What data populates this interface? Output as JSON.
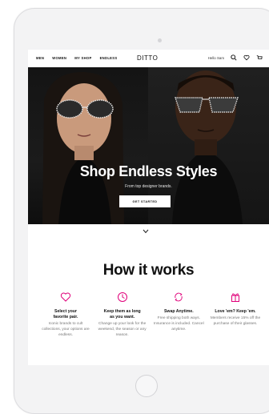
{
  "nav": {
    "links": [
      "MEN",
      "WOMEN",
      "MY SHOP",
      "ENDLESS"
    ],
    "logo": "DITTO",
    "greeting": "Hello Sam",
    "icons": [
      "search-icon",
      "heart-icon",
      "cart-icon"
    ]
  },
  "hero": {
    "title": "Shop Endless Styles",
    "subtitle": "From top designer brands.",
    "cta_label": "GET STARTED"
  },
  "how_it_works": {
    "title": "How it works",
    "accent_color": "#e0007a",
    "steps": [
      {
        "icon": "heart-icon",
        "title_line1": "Select your",
        "title_line2": "favorite pair.",
        "desc": "Iconic brands to cult collections, your options are endless."
      },
      {
        "icon": "clock-icon",
        "title_line1": "Keep them as long",
        "title_line2": "as you want.",
        "desc": "Change up your look for the weekend, the season or any reason."
      },
      {
        "icon": "swap-icon",
        "title_line1": "Swap Anytime.",
        "title_line2": "",
        "desc": "Free shipping both ways. Insurance is included. Cancel anytime."
      },
      {
        "icon": "gift-icon",
        "title_line1": "Love 'em? Keep 'em.",
        "title_line2": "",
        "desc": "Members receive 15% off the purchase of their glasses."
      }
    ]
  }
}
